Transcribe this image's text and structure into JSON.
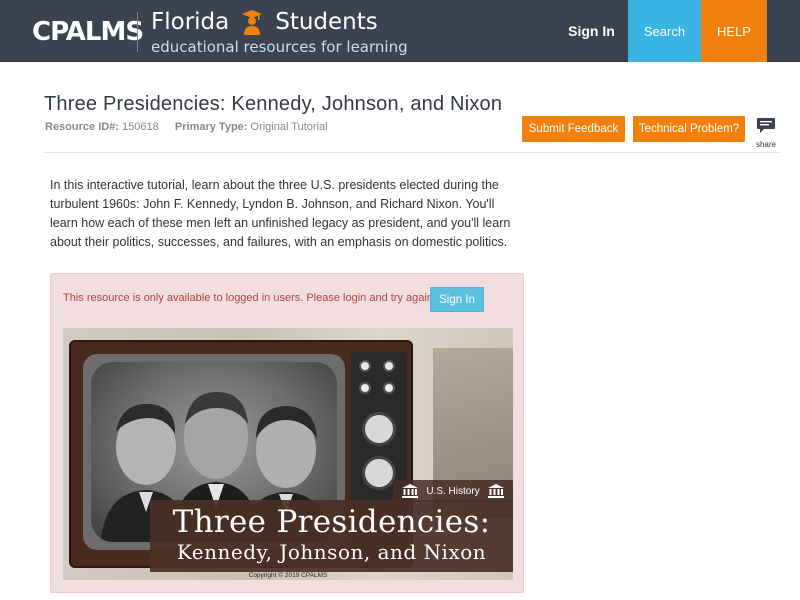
{
  "header": {
    "logo_text": "CPALMS",
    "brand_word1": "Florida",
    "brand_word2": "Students",
    "brand_tagline": "educational resources for learning",
    "nav": {
      "signin": "Sign In",
      "search": "Search",
      "help": "HELP"
    }
  },
  "resource": {
    "title": "Three Presidencies: Kennedy, Johnson, and Nixon",
    "id_label": "Resource ID#:",
    "id_value": "150618",
    "type_label": "Primary Type:",
    "type_value": "Original Tutorial",
    "submit_feedback": "Submit Feedback",
    "technical_problem": "Technical Problem?",
    "share_label": "share",
    "description": "In this interactive tutorial, learn about the three U.S. presidents elected during the turbulent 1960s: John F. Kennedy, Lyndon B. Johnson, and Richard Nixon.  You'll learn how each of these men left an unfinished legacy as president, and you'll learn about their politics, successes, and failures, with an emphasis on domestic politics."
  },
  "alert": {
    "message": "This resource is only available to logged in users. Please login and try again.",
    "signin_button": "Sign In"
  },
  "banner": {
    "subject_tag": "U.S. History",
    "title_main": "Three Presidencies:",
    "title_sub": "Kennedy, Johnson, and Nixon",
    "copyright": "Copyright © 2019 CPALMS"
  },
  "colors": {
    "header_bg": "#3b4351",
    "search_blue": "#39b3e2",
    "help_orange": "#f0810c",
    "alert_bg": "#f2dede",
    "alert_text": "#a94442",
    "info_button": "#5bc0de"
  },
  "icons": [
    "student-icon",
    "share-icon",
    "column-icon"
  ]
}
